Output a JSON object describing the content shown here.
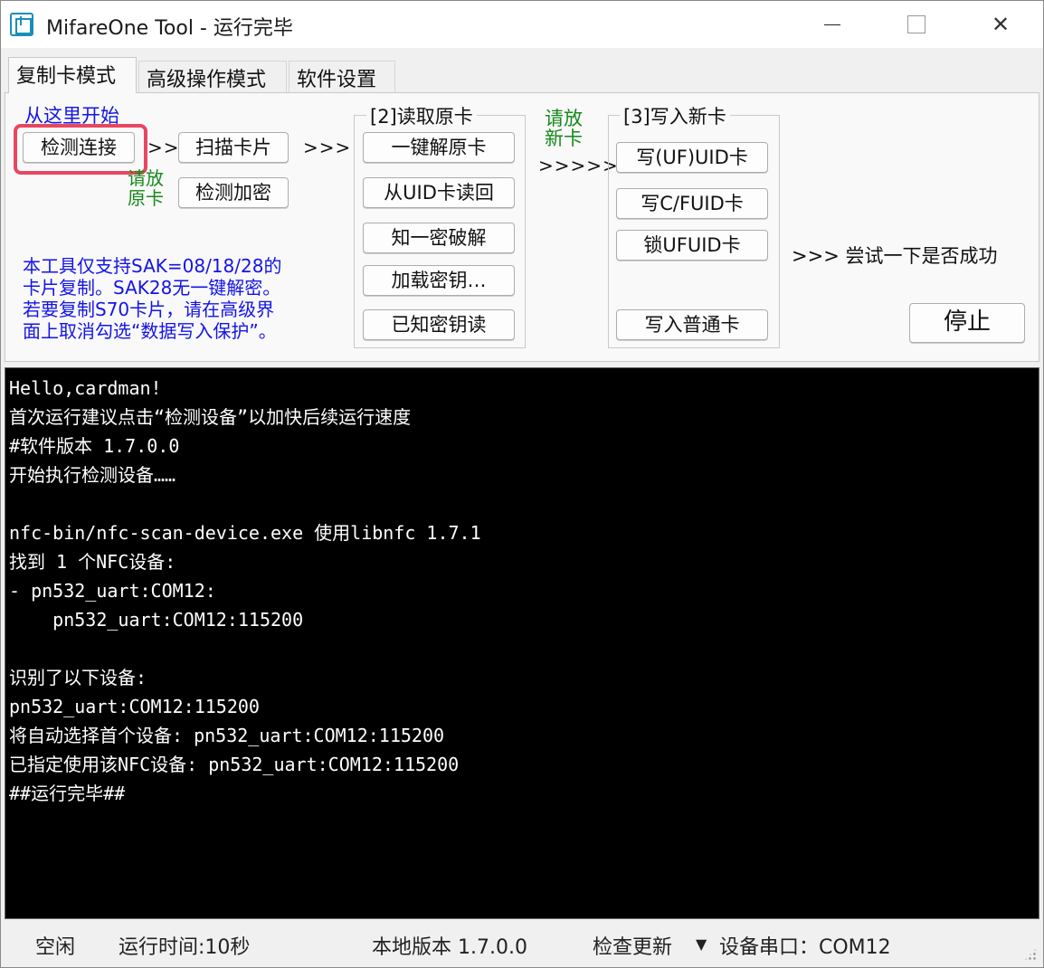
{
  "window": {
    "title": "MifareOne Tool - 运行完毕",
    "minimize_glyph": "—",
    "close_glyph": "✕"
  },
  "tabs": [
    {
      "label": "复制卡模式",
      "active": true
    },
    {
      "label": "高级操作模式",
      "active": false
    },
    {
      "label": "软件设置",
      "active": false
    }
  ],
  "panel": {
    "start_hint": "从这里开始",
    "detect_button": "检测连接",
    "arrow_small": ">>",
    "scan_button": "扫描卡片",
    "arrow_large": ">>>",
    "place_original": [
      "请放",
      "原卡"
    ],
    "check_encrypt_button": "检测加密",
    "note_lines": [
      "本工具仅支持SAK=08/18/28的",
      "卡片复制。SAK28无一键解密。",
      "若要复制S70卡片，请在高级界",
      "面上取消勾选“数据写入保护”。"
    ],
    "read_group": {
      "title": "[2]读取原卡",
      "buttons": [
        "一键解原卡",
        "从UID卡读回",
        "知一密破解",
        "加载密钥…",
        "已知密钥读"
      ]
    },
    "place_new": [
      "请放",
      "新卡"
    ],
    "arrow_new": ">>>>>",
    "write_group": {
      "title": "[3]写入新卡",
      "buttons": [
        "写(UF)UID卡",
        "写C/FUID卡",
        "锁UFUID卡",
        "写入普通卡"
      ]
    },
    "try_hint": ">>> 尝试一下是否成功",
    "stop_button": "停止"
  },
  "console": {
    "lines": [
      "Hello,cardman!",
      "首次运行建议点击“检测设备”以加快后续运行速度",
      "#软件版本 1.7.0.0",
      "开始执行检测设备……",
      "",
      "nfc-bin/nfc-scan-device.exe 使用libnfc 1.7.1",
      "找到 1 个NFC设备:",
      "- pn532_uart:COM12:",
      "    pn532_uart:COM12:115200",
      "",
      "识别了以下设备:",
      "pn532_uart:COM12:115200",
      "将自动选择首个设备: pn532_uart:COM12:115200",
      "已指定使用该NFC设备: pn532_uart:COM12:115200",
      "##运行完毕##"
    ]
  },
  "statusbar": {
    "state": "空闲",
    "runtime": "运行时间:10秒",
    "version": "本地版本 1.7.0.0",
    "check_update": "检查更新",
    "dropdown_glyph": "▼",
    "port": "设备串口：COM12"
  },
  "colors": {
    "hint_blue": "#1414e6",
    "hint_green": "#16891a",
    "focus_ring": "#e8475f",
    "console_bg": "#000000",
    "console_fg": "#ffffff"
  }
}
